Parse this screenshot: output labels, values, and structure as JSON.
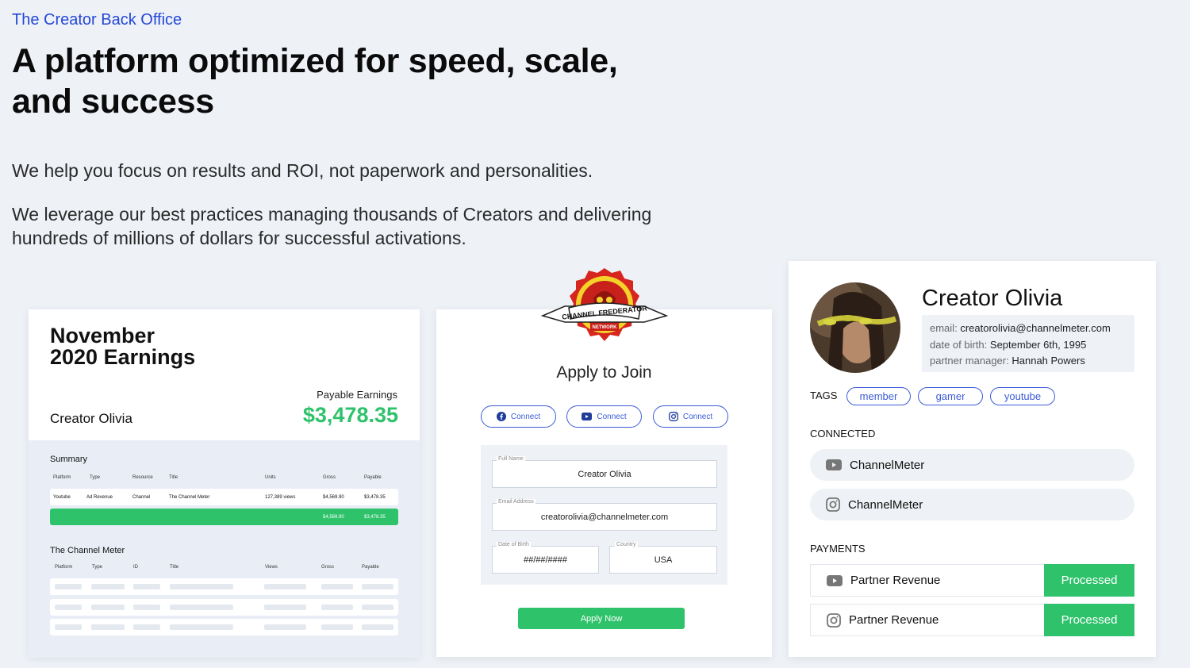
{
  "hero": {
    "eyebrow": "The Creator Back Office",
    "headline": "A platform optimized for speed, scale, and success",
    "para1": "We help you focus on results and ROI, not paperwork and personalities.",
    "para2": "We leverage our best practices managing thousands of Creators and delivering hundreds of millions of dollars for successful activations."
  },
  "earnings": {
    "title_line1": "November",
    "title_line2": "2020 Earnings",
    "creator": "Creator Olivia",
    "payable_label": "Payable Earnings",
    "payable_value": "$3,478.35",
    "summary_title": "Summary",
    "summary_headers": [
      "Platform",
      "Type",
      "Resource",
      "Title",
      "Units",
      "Gross",
      "Payable"
    ],
    "summary_row": [
      "Youtube",
      "Ad Revenue",
      "Channel",
      "The Channel Meter",
      "127,389 views",
      "$4,569.90",
      "$3,478.35"
    ],
    "summary_total": [
      "$4,569.90",
      "$3,478.35"
    ],
    "tcm_title": "The Channel Meter",
    "tcm_headers": [
      "Platform",
      "Type",
      "ID",
      "Title",
      "Views",
      "Gross",
      "Payable"
    ]
  },
  "apply": {
    "logo_text": "CHANNEL FREDERATOR",
    "logo_sub": "NETWORK",
    "title": "Apply to Join",
    "connect_labels": [
      "Connect",
      "Connect",
      "Connect"
    ],
    "full_name_label": "Full Name",
    "full_name_value": "Creator Olivia",
    "email_label": "Email Address",
    "email_value": "creatorolivia@channelmeter.com",
    "dob_label": "Date of Birth",
    "dob_value": "##/##/####",
    "country_label": "Country",
    "country_value": "USA",
    "button": "Apply Now"
  },
  "profile": {
    "name": "Creator Olivia",
    "email_label": "email:",
    "email": "creatorolivia@channelmeter.com",
    "dob_label": "date of birth:",
    "dob": "September 6th, 1995",
    "pm_label": "partner manager:",
    "pm": "Hannah Powers",
    "tags_label": "TAGS",
    "tags": [
      "member",
      "gamer",
      "youtube"
    ],
    "connected_label": "CONNECTED",
    "connected": [
      "ChannelMeter",
      "ChannelMeter"
    ],
    "payments_label": "PAYMENTS",
    "payments": [
      {
        "label": "Partner Revenue",
        "status": "Processed"
      },
      {
        "label": "Partner Revenue",
        "status": "Processed"
      }
    ]
  },
  "colors": {
    "accent_blue": "#2447d6",
    "green": "#2ec26b",
    "background": "#eef2f7"
  }
}
